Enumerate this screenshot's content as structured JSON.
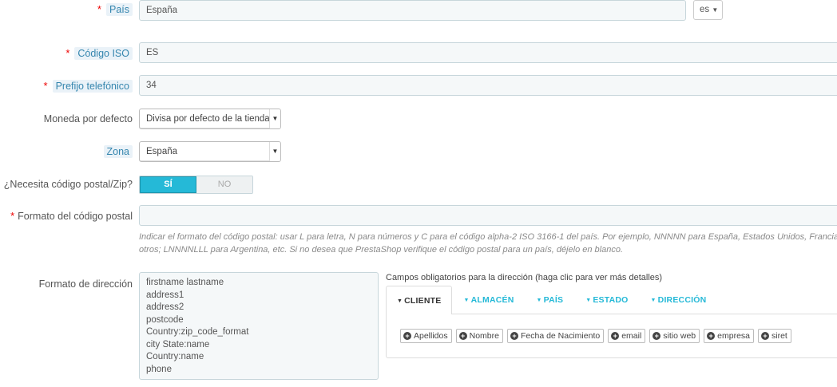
{
  "form": {
    "pais": {
      "label": "País",
      "required": "*",
      "value": "España",
      "lang": "es"
    },
    "iso": {
      "label": "Código ISO",
      "required": "*",
      "value": "ES"
    },
    "prefijo": {
      "label": "Prefijo telefónico",
      "required": "*",
      "value": "34"
    },
    "moneda": {
      "label": "Moneda por defecto",
      "value": "Divisa por defecto de la tienda"
    },
    "zona": {
      "label": "Zona",
      "value": "España"
    },
    "postal": {
      "label": "¿Necesita código postal/Zip?",
      "yes": "SÍ",
      "no": "NO"
    },
    "formato_postal": {
      "label": "Formato del código postal",
      "required": "*",
      "value": "",
      "help_line1": "Indicar el formato del código postal: usar L para letra, N para números y C para el código alpha-2 ISO 3166-1 del país. Por ejemplo, NNNNN para España, Estados Unidos, Francia, Italia y muchos",
      "help_line2": "otros; LNNNNLLL para Argentina, etc. Si no desea que PrestaShop verifique el código postal para un país, déjelo en blanco."
    },
    "direccion": {
      "label": "Formato de dirección",
      "lines": [
        "firstname lastname",
        "address1",
        "address2",
        "postcode",
        "Country:zip_code_format",
        "city State:name",
        "Country:name",
        "phone"
      ]
    }
  },
  "campos": {
    "title": "Campos obligatorios para la dirección (haga clic para ver más detalles)",
    "tabs": [
      "CLIENTE",
      "ALMACÉN",
      "PAÍS",
      "ESTADO",
      "DIRECCIÓN"
    ],
    "active_tab": "CLIENTE",
    "chips": [
      "Apellidos",
      "Nombre",
      "Fecha de Nacimiento",
      "email",
      "sitio web",
      "empresa",
      "siret"
    ]
  },
  "icons": {
    "caret": "caret-down-icon",
    "plus": "plus-circle-icon"
  },
  "colors": {
    "accent": "#25b9d7",
    "required": "#e00000",
    "label_highlight": "#3586ae"
  }
}
